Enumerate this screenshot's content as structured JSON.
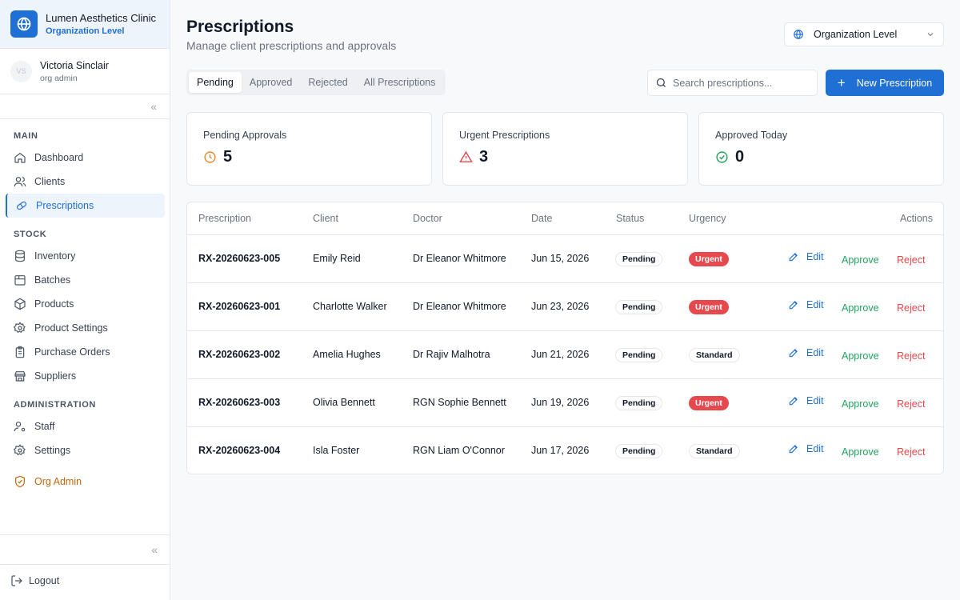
{
  "sidebar": {
    "org_name": "Lumen Aesthetics Clinic",
    "org_level": "Organization Level",
    "user_initials": "VS",
    "user_name": "Victoria Sinclair",
    "user_role": "org admin",
    "sections": {
      "main": "MAIN",
      "stock": "STOCK",
      "administration": "ADMINISTRATION"
    },
    "items": {
      "dashboard": "Dashboard",
      "clients": "Clients",
      "prescriptions": "Prescriptions",
      "inventory": "Inventory",
      "batches": "Batches",
      "products": "Products",
      "product_settings": "Product Settings",
      "purchase_orders": "Purchase Orders",
      "suppliers": "Suppliers",
      "staff": "Staff",
      "settings": "Settings",
      "org_admin": "Org Admin"
    },
    "logout": "Logout",
    "collapse_glyph": "«",
    "active_item": "prescriptions"
  },
  "header": {
    "title": "Prescriptions",
    "subtitle": "Manage client prescriptions and approvals",
    "org_select": "Organization Level"
  },
  "tabs": [
    "Pending",
    "Approved",
    "Rejected",
    "All Prescriptions"
  ],
  "active_tab": "Pending",
  "search": {
    "placeholder": "Search prescriptions..."
  },
  "new_button": "New Prescription",
  "stats": {
    "pending": {
      "label": "Pending Approvals",
      "value": "5"
    },
    "urgent": {
      "label": "Urgent Prescriptions",
      "value": "3"
    },
    "approved": {
      "label": "Approved Today",
      "value": "0"
    }
  },
  "table": {
    "headers": {
      "prescription": "Prescription",
      "client": "Client",
      "doctor": "Doctor",
      "date": "Date",
      "status": "Status",
      "urgency": "Urgency",
      "actions": "Actions"
    },
    "actions": {
      "edit": "Edit",
      "approve": "Approve",
      "reject": "Reject"
    },
    "rows": [
      {
        "id": "RX-20260623-005",
        "client": "Emily Reid",
        "doctor": "Dr Eleanor Whitmore",
        "date": "Jun 15, 2026",
        "status": "Pending",
        "urgency": "Urgent"
      },
      {
        "id": "RX-20260623-001",
        "client": "Charlotte Walker",
        "doctor": "Dr Eleanor Whitmore",
        "date": "Jun 23, 2026",
        "status": "Pending",
        "urgency": "Urgent"
      },
      {
        "id": "RX-20260623-002",
        "client": "Amelia Hughes",
        "doctor": "Dr Rajiv Malhotra",
        "date": "Jun 21, 2026",
        "status": "Pending",
        "urgency": "Standard"
      },
      {
        "id": "RX-20260623-003",
        "client": "Olivia Bennett",
        "doctor": "RGN Sophie Bennett",
        "date": "Jun 19, 2026",
        "status": "Pending",
        "urgency": "Urgent"
      },
      {
        "id": "RX-20260623-004",
        "client": "Isla Foster",
        "doctor": "RGN Liam O'Connor",
        "date": "Jun 17, 2026",
        "status": "Pending",
        "urgency": "Standard"
      }
    ]
  },
  "colors": {
    "accent": "#1f6fd4",
    "urgent": "#e5484d",
    "approve": "#22a45d",
    "warning": "#e8892b",
    "org_admin": "#c2670c"
  },
  "icons": {
    "org_logo": "globe-icon",
    "pending_stat": "clock-icon",
    "urgent_stat": "alert-triangle-icon",
    "approved_stat": "check-circle-icon",
    "edit": "pencil-icon",
    "search": "search-icon",
    "logout": "logout-icon"
  }
}
